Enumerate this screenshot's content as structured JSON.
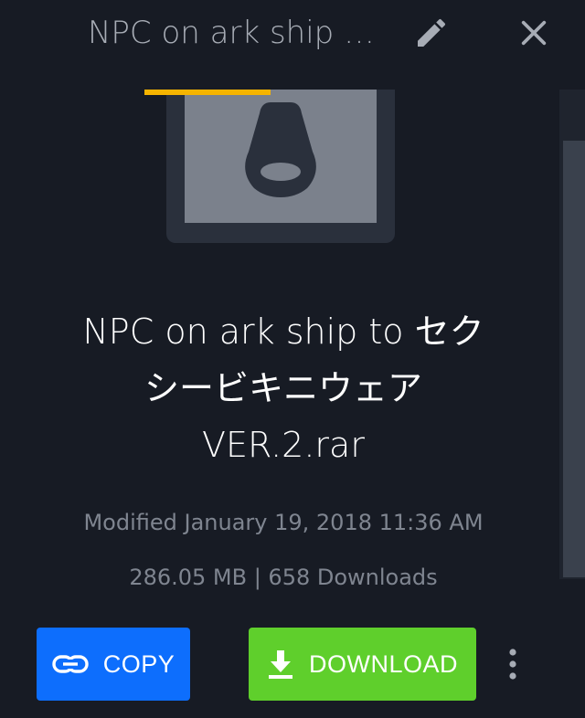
{
  "header": {
    "title": "NPC on ark ship …",
    "edit_icon": "pencil-icon",
    "close_icon": "close-icon"
  },
  "thumbnail": {
    "icon": "archive-zipper-icon",
    "upload_progress_percent": 50,
    "progress_color": "#f6b400"
  },
  "file": {
    "name_line1": "NPC on ark ship to セク",
    "name_line2": "シービキニウェア",
    "name_line3": "VER.2.rar",
    "modified": "Modified January 19, 2018 11:36 AM",
    "size_downloads": "286.05 MB | 658 Downloads"
  },
  "actions": {
    "copy_label": "COPY",
    "copy_icon": "link-icon",
    "copy_color": "#0d6efd",
    "download_label": "DOWNLOAD",
    "download_icon": "download-icon",
    "download_color": "#5fcf2c",
    "more_icon": "more-vertical-icon"
  }
}
